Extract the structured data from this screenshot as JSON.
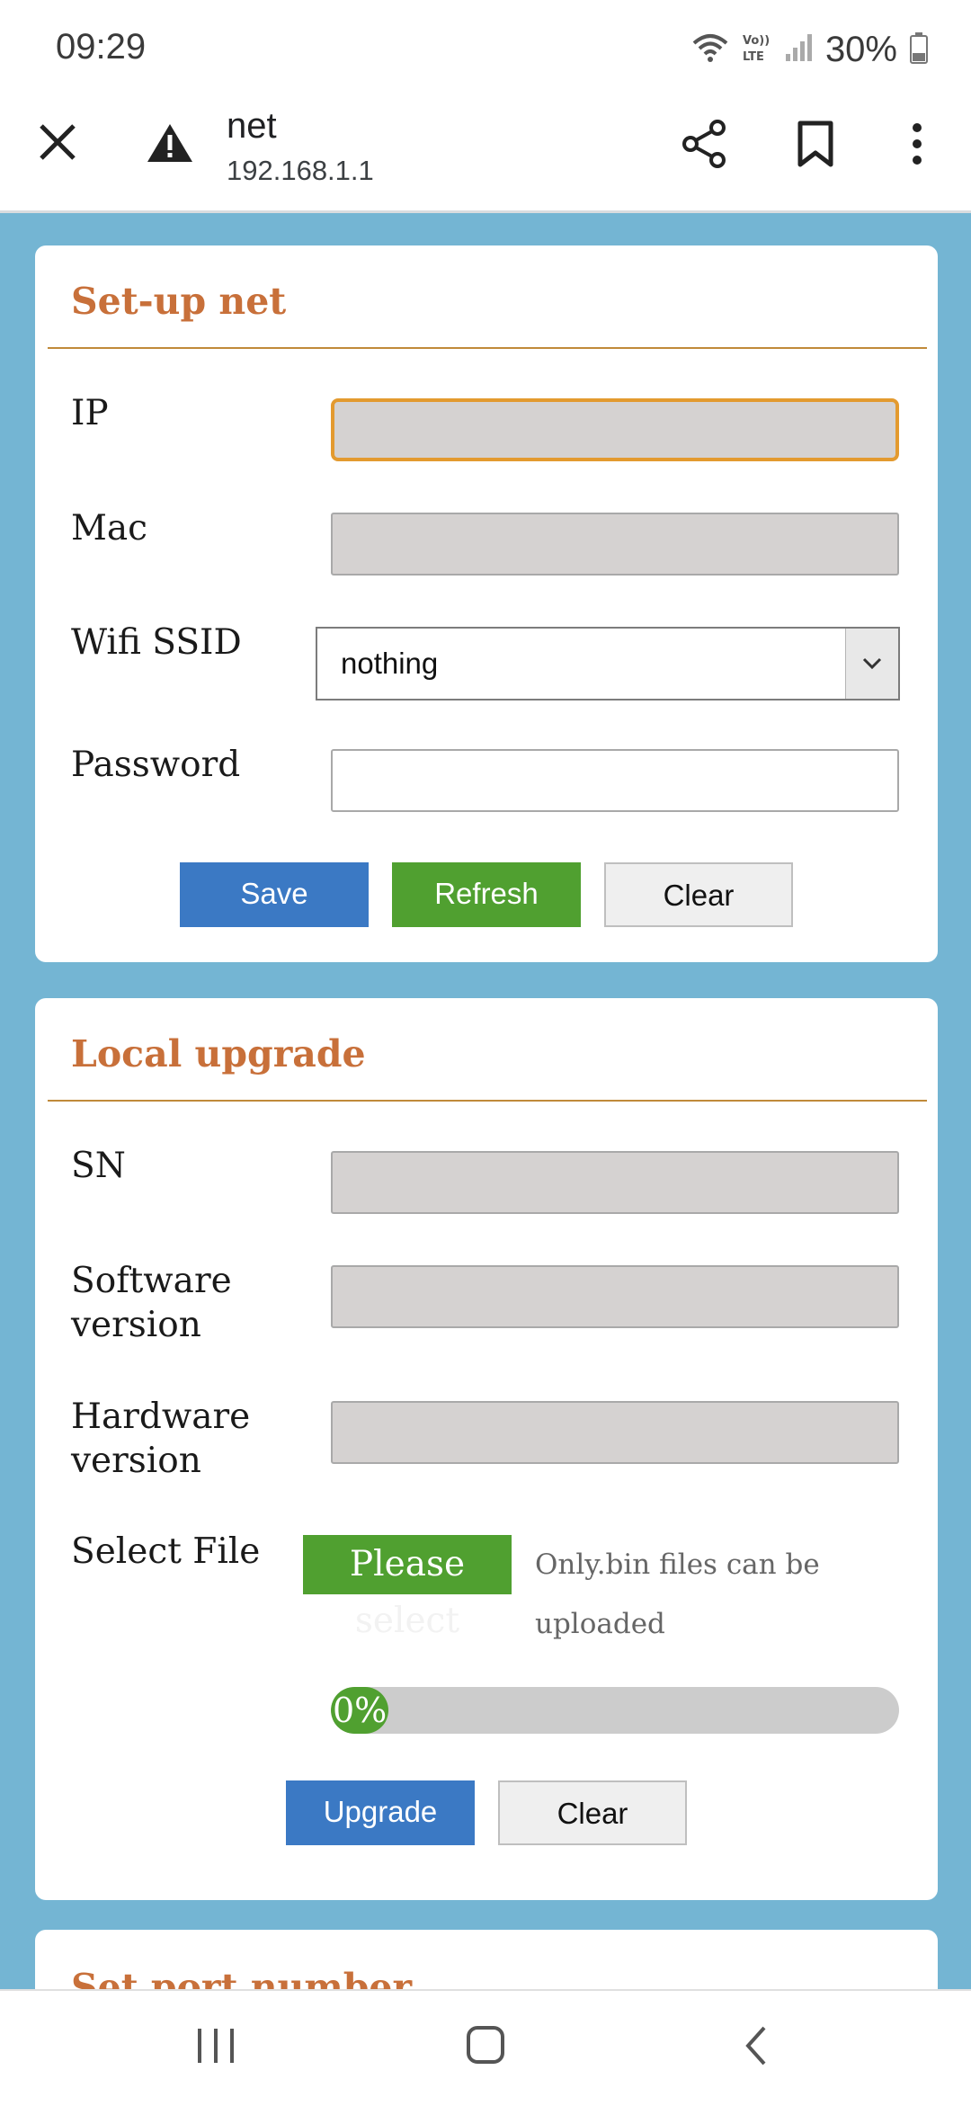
{
  "status_bar": {
    "time": "09:29",
    "battery_percent": "30%",
    "icons": [
      "wifi-icon",
      "volte-icon",
      "signal-icon",
      "battery-icon"
    ]
  },
  "browser": {
    "title": "net",
    "url": "192.168.1.1",
    "icons": [
      "close-icon",
      "warning-icon",
      "share-icon",
      "bookmark-icon",
      "more-icon"
    ]
  },
  "setup_net": {
    "heading": "Set-up net",
    "ip_label": "IP",
    "ip_value": "",
    "mac_label": "Mac",
    "mac_value": "",
    "ssid_label": "Wifi SSID",
    "ssid_selected": "nothing",
    "password_label": "Password",
    "password_value": "",
    "save_label": "Save",
    "refresh_label": "Refresh",
    "clear_label": "Clear"
  },
  "local_upgrade": {
    "heading": "Local upgrade",
    "sn_label": "SN",
    "software_label_line1": "Software",
    "software_label_line2": "version",
    "hardware_label_line1": "Hardware",
    "hardware_label_line2": "version",
    "select_file_label": "Select File",
    "select_btn_line1": "Please",
    "select_btn_line2": "select",
    "file_hint_line1": "Only.bin files can be",
    "file_hint_line2": "uploaded",
    "progress_text": "0%",
    "progress_value": 0,
    "upgrade_label": "Upgrade",
    "clear_label": "Clear"
  },
  "set_port": {
    "heading": "Set port number"
  },
  "colors": {
    "accent_heading": "#c8703a",
    "background": "#74b5d3",
    "button_blue": "#3b79c4",
    "button_green": "#50a030"
  }
}
